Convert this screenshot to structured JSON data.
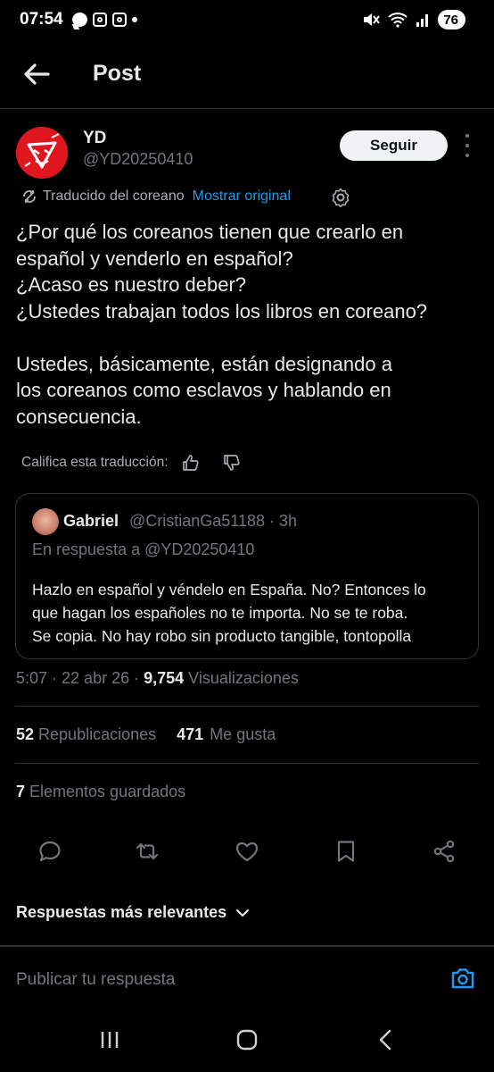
{
  "status_bar": {
    "time": "07:54",
    "battery": "76"
  },
  "top_bar": {
    "title": "Post"
  },
  "post": {
    "author_name": "YD",
    "author_handle": "@YD20250410",
    "follow_label": "Seguir",
    "translated_label": "Traducido del coreano",
    "show_original_label": "Mostrar original",
    "text_lines": [
      "¿Por qué los coreanos tienen que crearlo en",
      "español y venderlo en español?",
      "¿Acaso es nuestro deber?",
      "¿Ustedes trabajan todos los libros en coreano?",
      "",
      "Ustedes, básicamente, están designando a",
      "los coreanos como esclavos y hablando en",
      "consecuencia."
    ],
    "rate_label": "Califica esta traducción:"
  },
  "quote": {
    "name": "Gabriel",
    "handle_time": "@CristianGa51188 · 3h",
    "reply_to": "En respuesta a @YD20250410",
    "text_lines": [
      "Hazlo en español y véndelo en España. No? Entonces lo",
      "que hagan los españoles no te importa. No se te roba.",
      "Se copia. No hay robo sin producto tangible, tontopolla"
    ]
  },
  "meta": {
    "time_date": "5:07 · 22 abr 26 · ",
    "views_count": "9,754",
    "views_label": " Visualizaciones"
  },
  "stats": {
    "reposts_count": "52",
    "reposts_label": " Republicaciones",
    "likes_count": "471",
    "likes_label": " Me gusta",
    "bookmarks_count": "7",
    "bookmarks_label": " Elementos guardados"
  },
  "replies": {
    "sort_label": "Respuestas más relevantes",
    "input_placeholder": "Publicar tu respuesta"
  },
  "colors": {
    "background": "#000000",
    "text": "#e7e9ea",
    "muted": "#71767b",
    "accent": "#1d9bf0",
    "divider": "#2f3336",
    "avatar_red": "#e0161f"
  }
}
